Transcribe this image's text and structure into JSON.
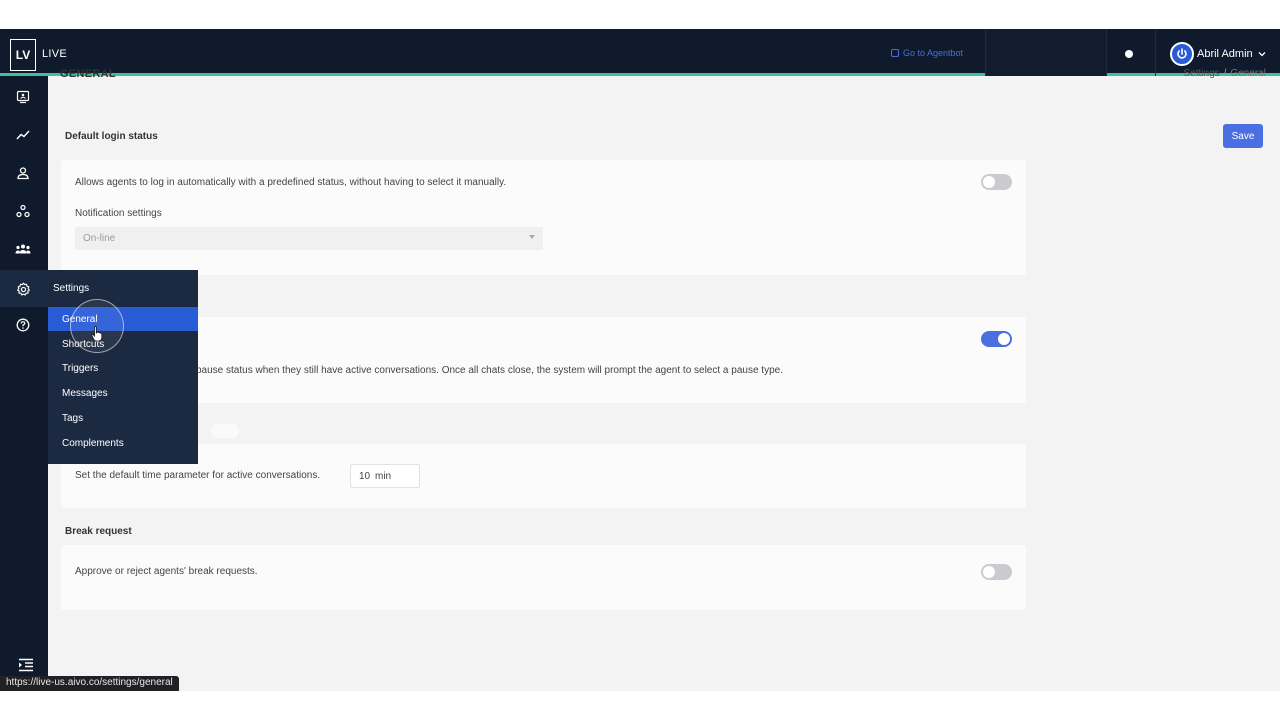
{
  "app": {
    "logo": "LV",
    "name": "LIVE"
  },
  "header": {
    "agentbot_link": "Go to Agentbot",
    "user_name": "Abril Admin"
  },
  "page": {
    "title": "GENERAL",
    "breadcrumb": [
      "Settings",
      "General"
    ],
    "save_label": "Save"
  },
  "sections": {
    "login": {
      "title": "Default login status",
      "description": "Allows agents to log in automatically with a predefined status, without having to select it manually.",
      "toggle_on": false,
      "notification_label": "Notification settings",
      "select_value": "On-line"
    },
    "pause": {
      "description_partial": "pause status when they still have active conversations. Once all chats close, the system will prompt the agent to select a pause type.",
      "toggle_on": true
    },
    "time": {
      "description": "Set the default time parameter for active conversations.",
      "value": "10",
      "unit": "min"
    },
    "break": {
      "title": "Break request",
      "description": "Approve or reject agents' break requests.",
      "toggle_on": false
    }
  },
  "menu": {
    "header": "Settings",
    "items": [
      "General",
      "Shortcuts",
      "Triggers",
      "Messages",
      "Tags",
      "Complements"
    ],
    "active_index": 0
  },
  "status_url": "https://live-us.aivo.co/settings/general",
  "colors": {
    "topbar": "#0f1a2c",
    "accent": "#4a6fe0",
    "active_menu": "#2a5bd7",
    "topbar_border": "#3fbf9a"
  },
  "icons": [
    "monitor-icon",
    "trend-icon",
    "user-icon",
    "network-icon",
    "team-icon",
    "gear-icon",
    "help-icon",
    "collapse-menu-icon",
    "power-icon",
    "chevron-down-icon"
  ]
}
